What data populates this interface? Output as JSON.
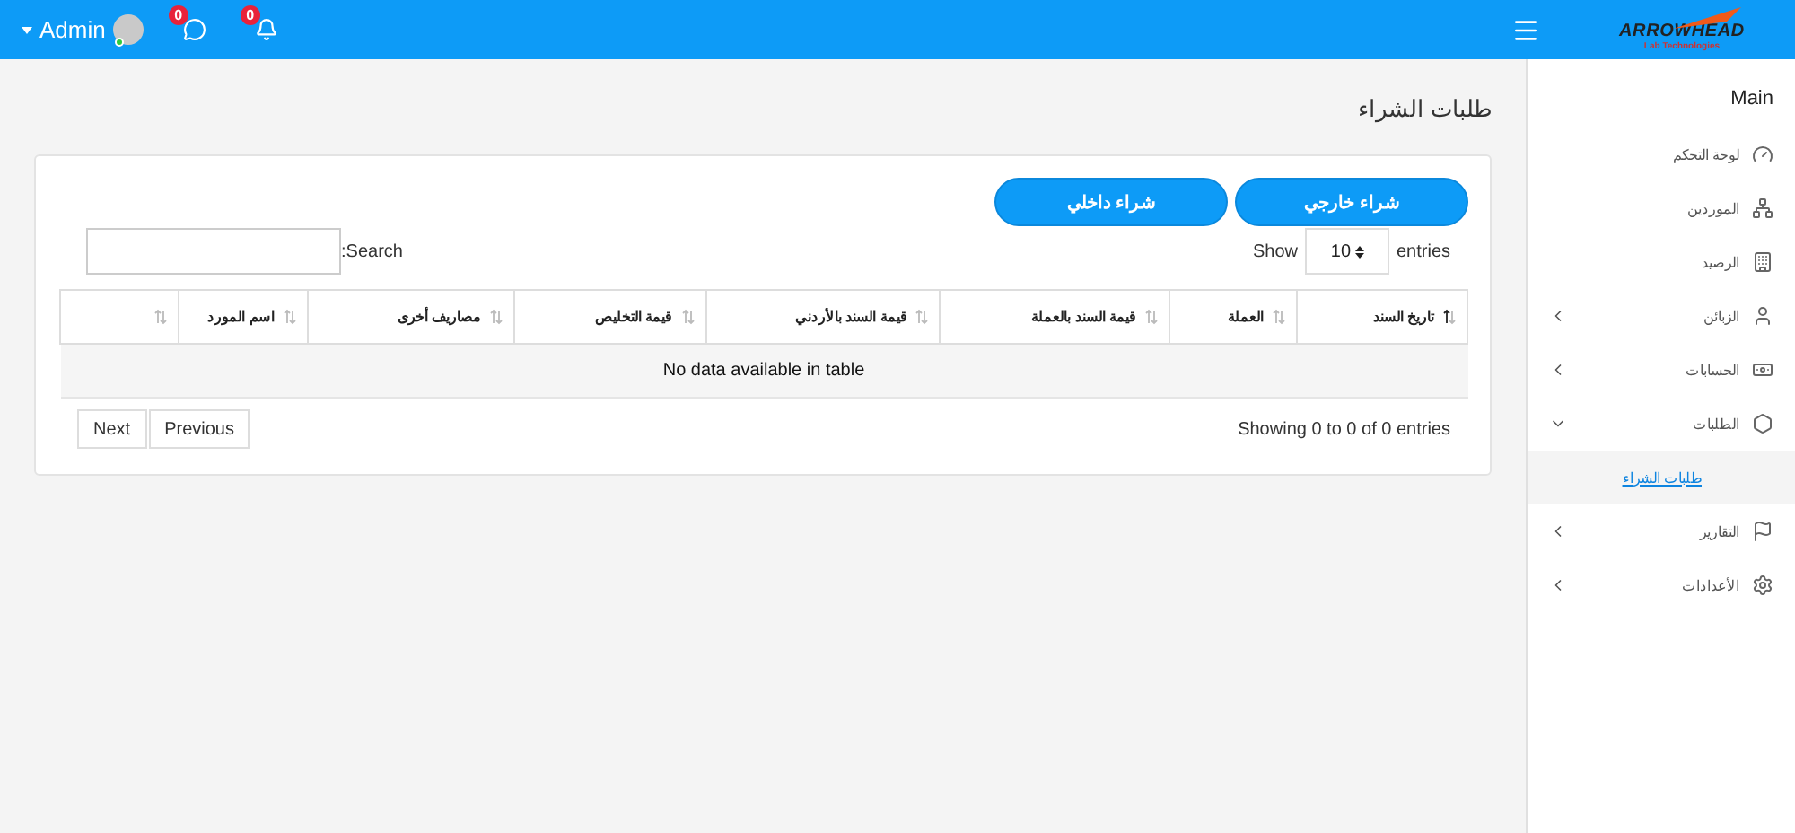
{
  "topbar": {
    "user": "Admin",
    "online": true,
    "messages_badge": "0",
    "notifications_badge": "0"
  },
  "logo": {
    "name": "ARROWHEAD",
    "tagline": "Lab Technologies"
  },
  "sidebar": {
    "items": [
      {
        "kind": "header",
        "label": "Main"
      },
      {
        "kind": "item",
        "label": "لوحة التحكم"
      },
      {
        "kind": "item",
        "label": "الموردين"
      },
      {
        "kind": "item",
        "label": "الرصيد"
      },
      {
        "kind": "group",
        "label": "الزبائن",
        "expanded": false
      },
      {
        "kind": "group",
        "label": "الحسابات",
        "expanded": false
      },
      {
        "kind": "group",
        "label": "الطلبات",
        "expanded": true,
        "children": [
          {
            "label": "طلبات الشراء",
            "selected": true
          }
        ]
      },
      {
        "kind": "group",
        "label": "التقارير",
        "expanded": false
      },
      {
        "kind": "group",
        "label": "الأعدادات",
        "expanded": false
      }
    ]
  },
  "page_title": "طلبات الشراء",
  "buttons": [
    "شراء خارجي",
    "شراء داخلي"
  ],
  "length": {
    "before": "Show",
    "value": "10",
    "after": "entries"
  },
  "search": {
    "label": ":Search"
  },
  "table": {
    "columns": [
      {
        "label": "تاريخ السند",
        "sorted": true
      },
      {
        "label": "العملة",
        "sorted": false
      },
      {
        "label": "قيمة السند بالعملة",
        "sorted": false
      },
      {
        "label": "قيمة السند بالأردني",
        "sorted": false
      },
      {
        "label": "قيمة التخليص",
        "sorted": false
      },
      {
        "label": "مصاريف أخرى",
        "sorted": false
      },
      {
        "label": "اسم المورد",
        "sorted": false
      },
      {
        "sorted": false
      }
    ],
    "empty": "No data available in table"
  },
  "info": "Showing 0 to 0 of 0 entries",
  "pagination": [
    "Previous",
    "Next"
  ]
}
